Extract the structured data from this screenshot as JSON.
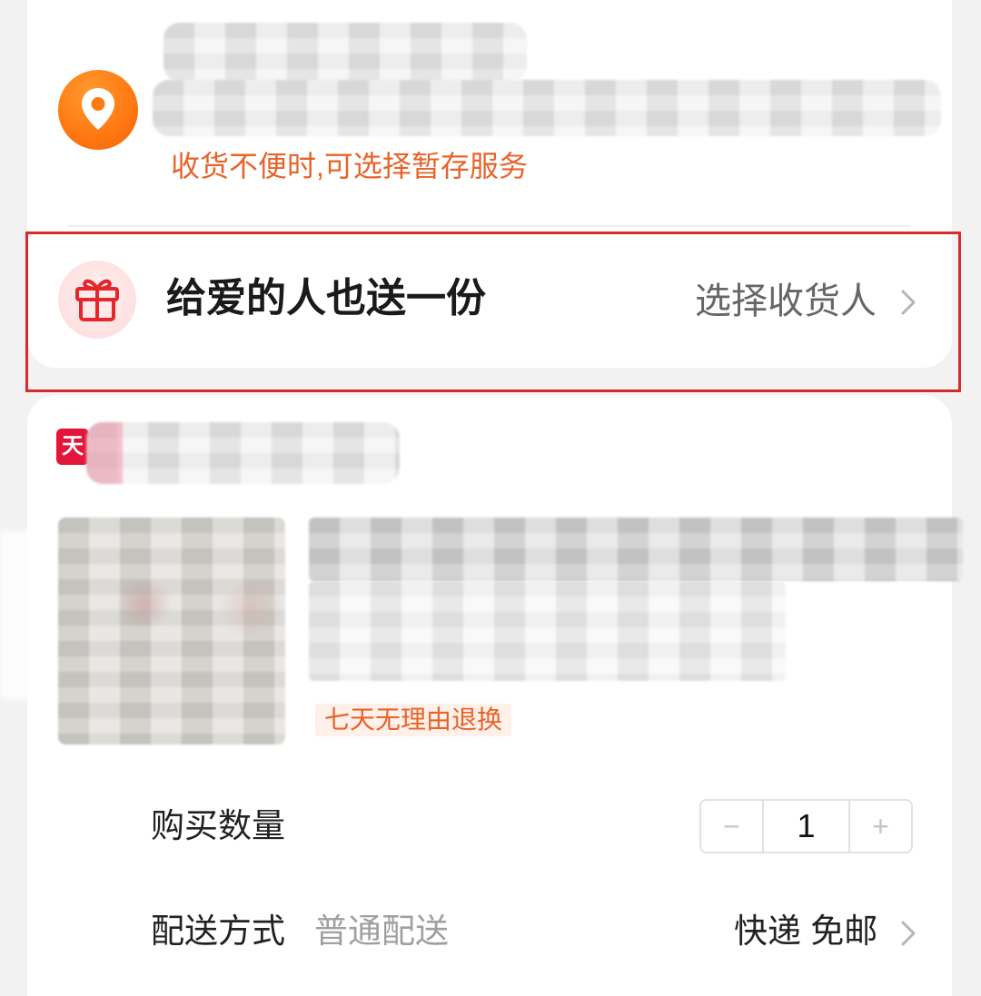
{
  "address": {
    "notice": "收货不便时,可选择暂存服务"
  },
  "gift": {
    "title": "给爱的人也送一份",
    "action": "选择收货人"
  },
  "shop": {
    "logo_text": "天"
  },
  "product": {
    "badge": "七天无理由退换"
  },
  "quantity": {
    "label": "购买数量",
    "minus": "−",
    "value": "1",
    "plus": "+"
  },
  "delivery": {
    "label": "配送方式",
    "type": "普通配送",
    "method": "快递 免邮"
  },
  "icons": {
    "address": "location-pin-icon",
    "gift": "gift-icon",
    "chevron": "chevron-right-icon",
    "shop": "tmall-logo"
  },
  "colors": {
    "accent_orange": "#ff7a12",
    "notice_text": "#e8632a",
    "gift_red": "#e5262d",
    "tmall_red": "#e4153a",
    "annotation_red": "#d52b2b",
    "page_background": "#f2f2f2"
  }
}
